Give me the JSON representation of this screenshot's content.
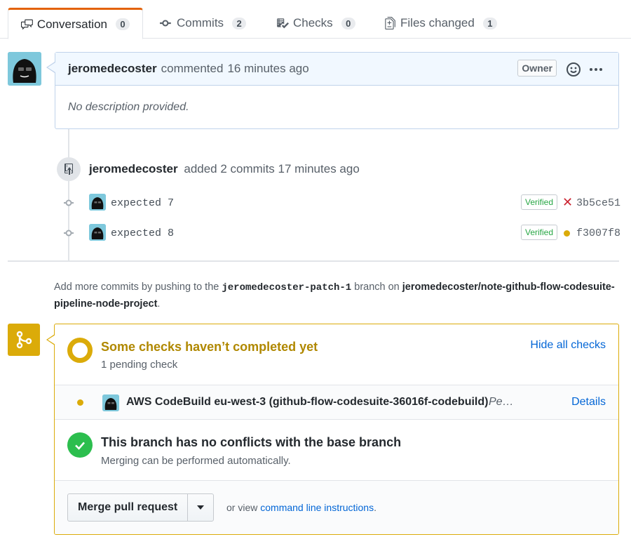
{
  "tabs": [
    {
      "label": "Conversation",
      "count": "0",
      "icon": "comment-discussion-icon"
    },
    {
      "label": "Commits",
      "count": "2",
      "icon": "git-commit-icon"
    },
    {
      "label": "Checks",
      "count": "0",
      "icon": "checklist-icon"
    },
    {
      "label": "Files changed",
      "count": "1",
      "icon": "file-diff-icon"
    }
  ],
  "comment": {
    "author": "jeromedecoster",
    "action": "commented",
    "time": "16 minutes ago",
    "role": "Owner",
    "body": "No description provided."
  },
  "push_event": {
    "author": "jeromedecoster",
    "text": "added 2 commits 17 minutes ago"
  },
  "commits": [
    {
      "message": "expected 7",
      "verified": "Verified",
      "status": "failure",
      "sha": "3b5ce51"
    },
    {
      "message": "expected 8",
      "verified": "Verified",
      "status": "pending",
      "sha": "f3007f8"
    }
  ],
  "hint": {
    "prefix": "Add more commits by pushing to the",
    "branch": "jeromedecoster-patch-1",
    "middle": "branch on",
    "repo": "jeromedecoster/note-github-flow-codesuite-pipeline-node-project",
    "suffix": "."
  },
  "checks": {
    "title": "Some checks haven’t completed yet",
    "subtitle": "1 pending check",
    "toggle_label": "Hide all checks",
    "items": [
      {
        "name": "AWS CodeBuild eu-west-3 (github-flow-codesuite-36016f-codebuild)",
        "description": "Pe…",
        "details_label": "Details"
      }
    ]
  },
  "conflicts": {
    "title": "This branch has no conflicts with the base branch",
    "subtitle": "Merging can be performed automatically."
  },
  "merge": {
    "button_label": "Merge pull request",
    "or_view": "or view",
    "cli_link": "command line instructions",
    "suffix": "."
  },
  "colors": {
    "pending": "#dbab09",
    "success": "#2cbe4e",
    "failure": "#cb2431",
    "link": "#0366d6"
  }
}
